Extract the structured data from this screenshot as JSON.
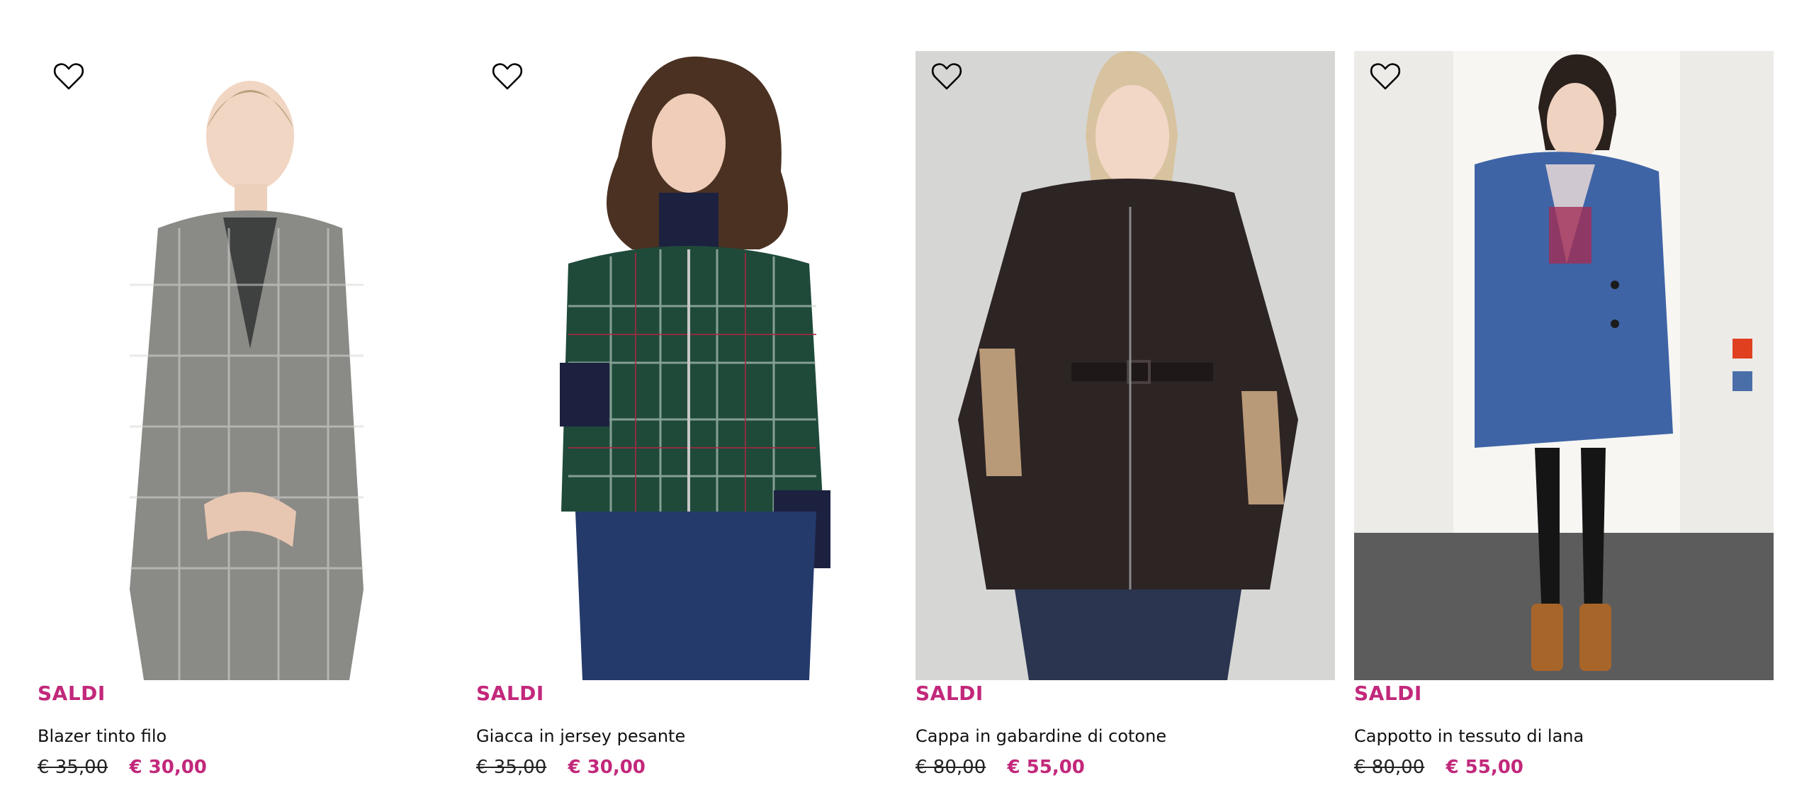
{
  "brand_color": "#c2287b",
  "products": [
    {
      "badge": "SALDI",
      "name": "Blazer tinto filo",
      "price_old": "€ 35,00",
      "price_new": "€ 30,00",
      "photo": "woman-grey-check-blazer-photo"
    },
    {
      "badge": "SALDI",
      "name": "Giacca in jersey pesante",
      "price_old": "€ 35,00",
      "price_new": "€ 30,00",
      "photo": "woman-green-tartan-bomber-photo"
    },
    {
      "badge": "SALDI",
      "name": "Cappa in gabardine di cotone",
      "price_old": "€ 80,00",
      "price_new": "€ 55,00",
      "photo": "woman-brown-cape-photo"
    },
    {
      "badge": "SALDI",
      "name": "Cappotto in tessuto di lana",
      "price_old": "€ 80,00",
      "price_new": "€ 55,00",
      "photo": "woman-blue-wool-coat-photo",
      "swatches": [
        {
          "name": "red",
          "color": "#e0401f"
        },
        {
          "name": "blue",
          "color": "#4a6fa8"
        }
      ]
    }
  ],
  "icons": {
    "wishlist": "heart-outline-icon"
  }
}
